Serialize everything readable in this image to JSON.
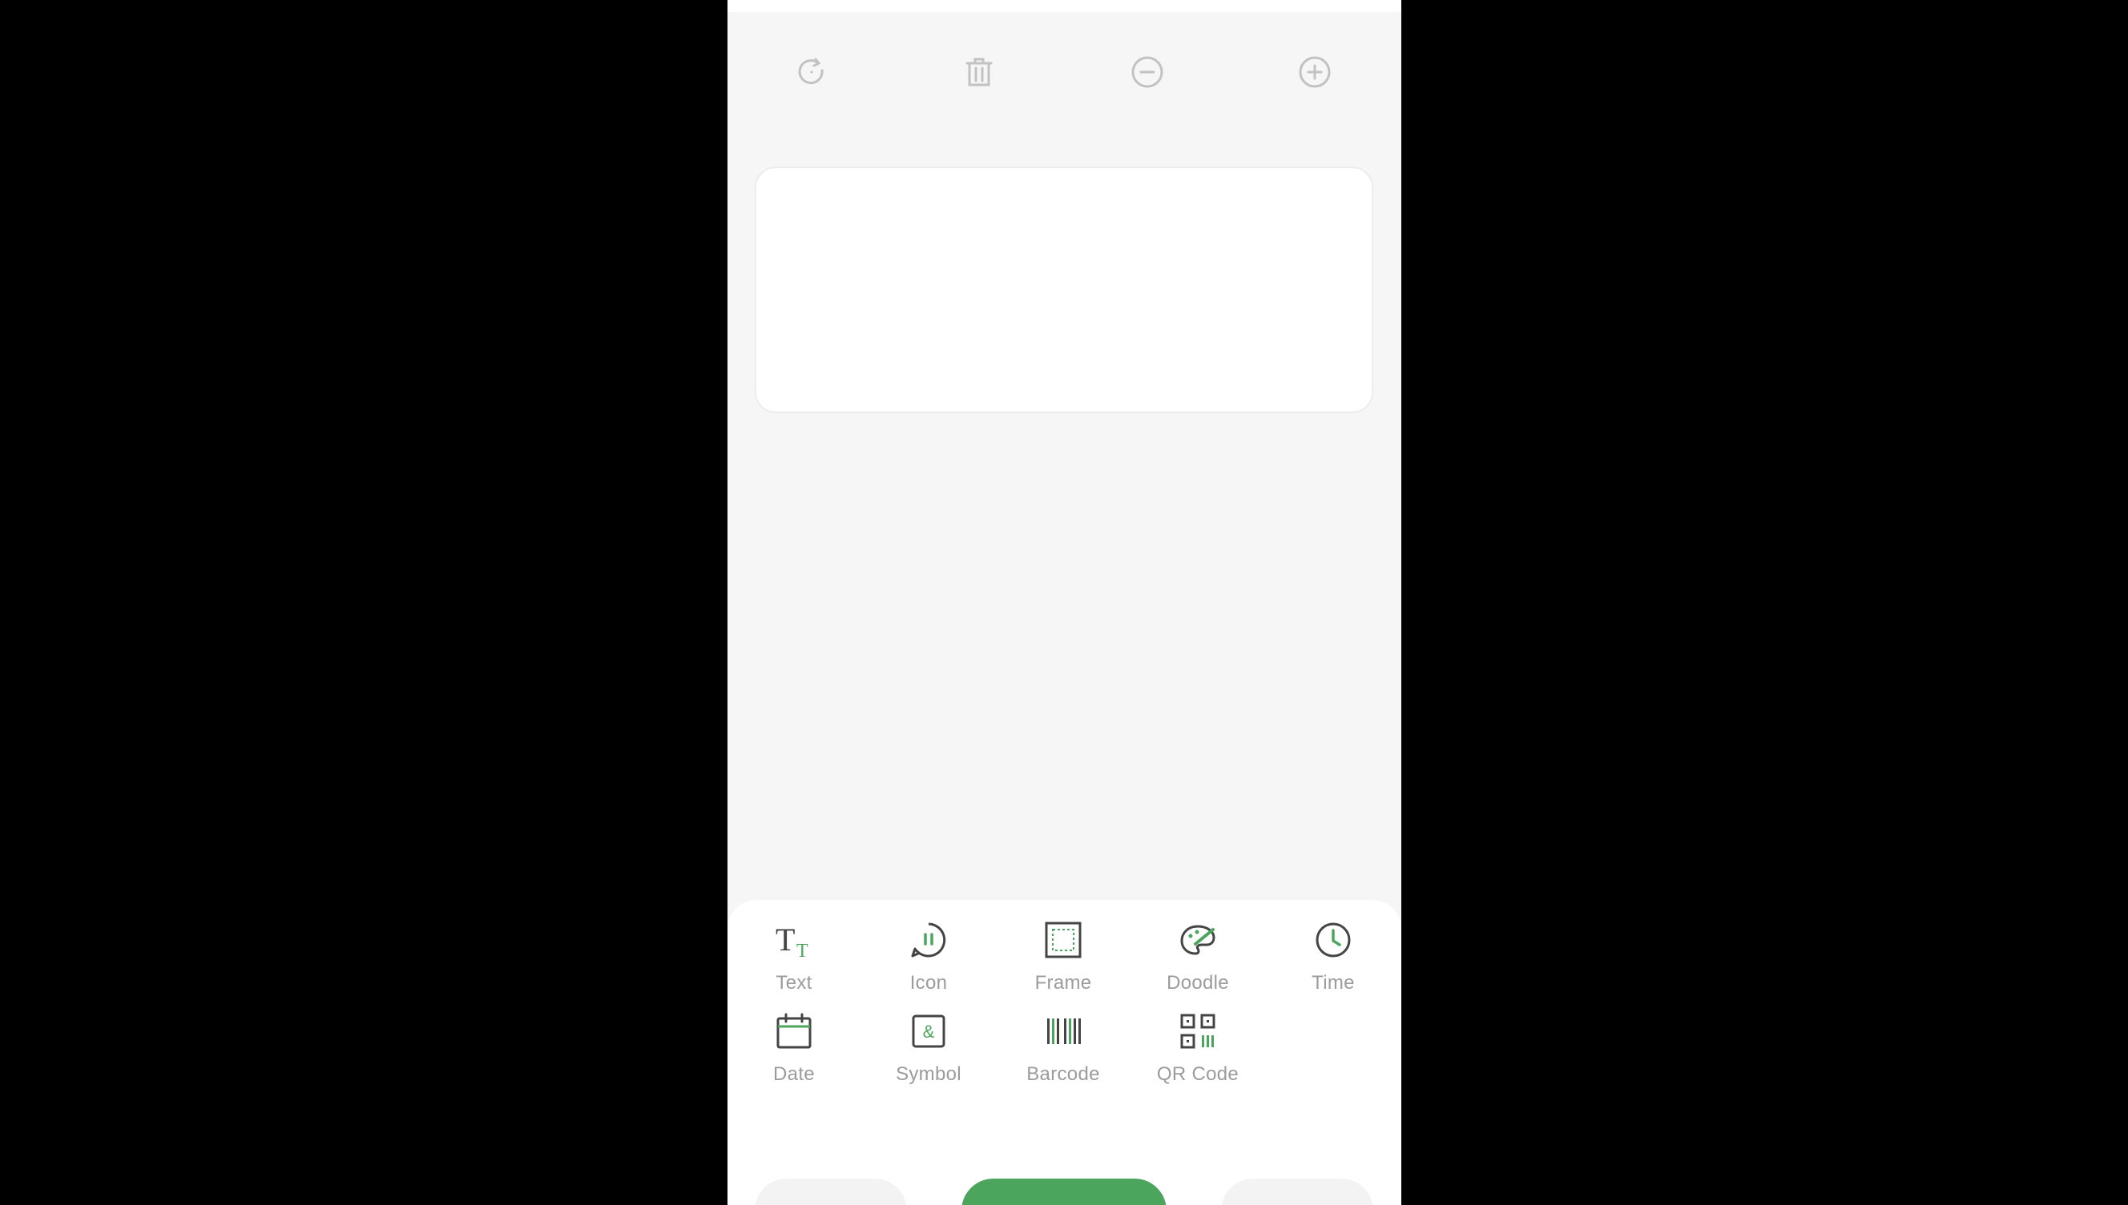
{
  "colors": {
    "accent_green": "#4ca55c",
    "icon_dark": "#444444",
    "toolbar_icon": "#c2c2c2",
    "label_gray": "#9b9b9b",
    "background": "#f6f6f6"
  },
  "toolbar": {
    "items": [
      {
        "icon": "refresh-icon"
      },
      {
        "icon": "trash-icon"
      },
      {
        "icon": "zoom-out-icon"
      },
      {
        "icon": "zoom-in-icon"
      }
    ]
  },
  "elements": {
    "items": [
      {
        "label": "Text",
        "icon": "text-icon"
      },
      {
        "label": "Icon",
        "icon": "emoji-icon"
      },
      {
        "label": "Frame",
        "icon": "frame-icon"
      },
      {
        "label": "Doodle",
        "icon": "palette-icon"
      },
      {
        "label": "Time",
        "icon": "clock-icon"
      },
      {
        "label": "Date",
        "icon": "calendar-icon"
      },
      {
        "label": "Symbol",
        "icon": "ampersand-icon"
      },
      {
        "label": "Barcode",
        "icon": "barcode-icon"
      },
      {
        "label": "QR Code",
        "icon": "qr-code-icon"
      }
    ]
  }
}
